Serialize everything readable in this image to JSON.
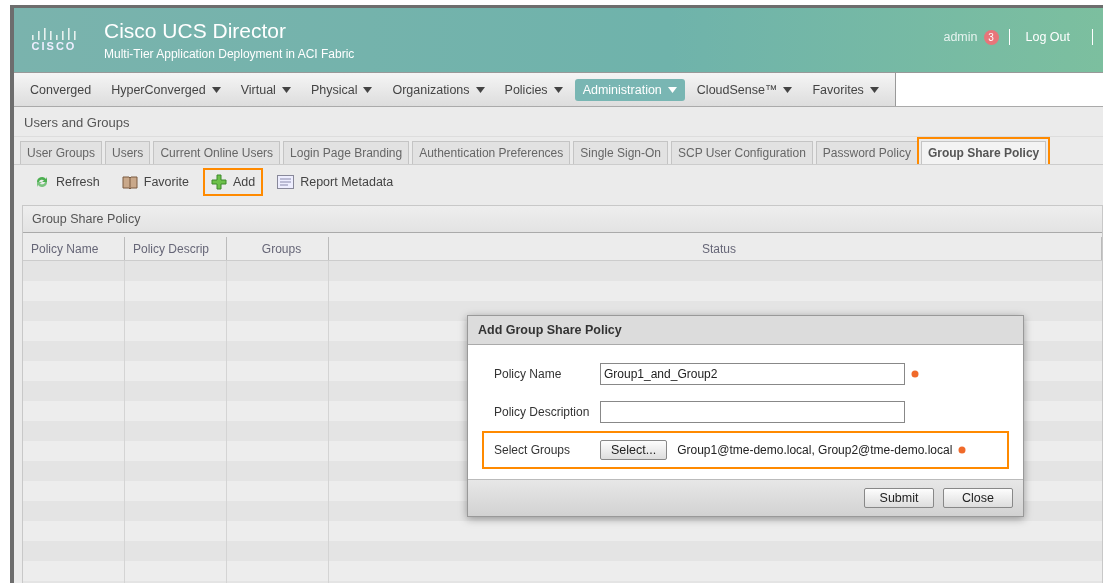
{
  "header": {
    "brand": "CISCO",
    "title": "Cisco UCS Director",
    "subtitle": "Multi-Tier Application Deployment in ACI Fabric",
    "user": "admin",
    "notifications": "3",
    "logout": "Log Out"
  },
  "nav": [
    {
      "label": "Converged",
      "dropdown": false,
      "selected": false
    },
    {
      "label": "HyperConverged",
      "dropdown": true,
      "selected": false
    },
    {
      "label": "Virtual",
      "dropdown": true,
      "selected": false
    },
    {
      "label": "Physical",
      "dropdown": true,
      "selected": false
    },
    {
      "label": "Organizations",
      "dropdown": true,
      "selected": false
    },
    {
      "label": "Policies",
      "dropdown": true,
      "selected": false
    },
    {
      "label": "Administration",
      "dropdown": true,
      "selected": true
    },
    {
      "label": "CloudSense™",
      "dropdown": true,
      "selected": false
    },
    {
      "label": "Favorites",
      "dropdown": true,
      "selected": false
    }
  ],
  "breadcrumb": "Users and Groups",
  "tabs": [
    {
      "label": "User Groups",
      "selected": false,
      "highlighted": false
    },
    {
      "label": "Users",
      "selected": false,
      "highlighted": false
    },
    {
      "label": "Current Online Users",
      "selected": false,
      "highlighted": false
    },
    {
      "label": "Login Page Branding",
      "selected": false,
      "highlighted": false
    },
    {
      "label": "Authentication Preferences",
      "selected": false,
      "highlighted": false
    },
    {
      "label": "Single Sign-On",
      "selected": false,
      "highlighted": false
    },
    {
      "label": "SCP User Configuration",
      "selected": false,
      "highlighted": false
    },
    {
      "label": "Password Policy",
      "selected": false,
      "highlighted": false
    },
    {
      "label": "Group Share Policy",
      "selected": true,
      "highlighted": true
    }
  ],
  "toolbar": [
    {
      "kind": "refresh",
      "label": "Refresh",
      "highlighted": false
    },
    {
      "kind": "favorite",
      "label": "Favorite",
      "highlighted": false
    },
    {
      "kind": "add",
      "label": "Add",
      "highlighted": true
    },
    {
      "kind": "report",
      "label": "Report Metadata",
      "highlighted": false
    }
  ],
  "panel": {
    "title": "Group Share Policy",
    "columns": [
      "Policy Name",
      "Policy Descrip",
      "Groups",
      "Status"
    ]
  },
  "dialog": {
    "title": "Add Group Share Policy",
    "fields": [
      {
        "kind": "text",
        "label": "Policy Name",
        "value": "Group1_and_Group2",
        "required": true,
        "highlighted": false
      },
      {
        "kind": "text",
        "label": "Policy Description",
        "required": false,
        "highlighted": false
      },
      {
        "kind": "select",
        "label": "Select Groups",
        "button": "Select...",
        "value": "Group1@tme-demo.local, Group2@tme-demo.local",
        "required": true,
        "highlighted": true
      }
    ],
    "buttons": [
      "Submit",
      "Close"
    ]
  }
}
